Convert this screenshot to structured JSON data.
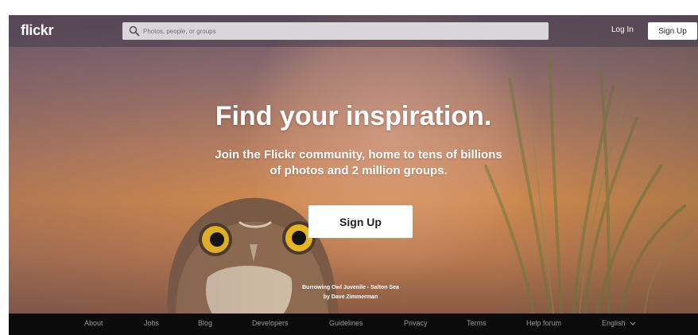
{
  "brand": {
    "logo_text": "flickr"
  },
  "search": {
    "placeholder": "Photos, people, or groups",
    "icon": "search-icon"
  },
  "nav": {
    "login_label": "Log In",
    "signup_label": "Sign Up"
  },
  "hero": {
    "headline": "Find your inspiration.",
    "subline_1": "Join the Flickr community, home to tens of billions",
    "subline_2": "of photos and 2 million groups.",
    "cta_label": "Sign Up",
    "photo_title": "Burrowing Owl Juvenile - Salton Sea",
    "photo_author": "by Dave Zimmerman"
  },
  "footer": {
    "links": [
      "About",
      "Jobs",
      "Blog",
      "Developers",
      "Guidelines",
      "Privacy",
      "Terms",
      "Help forum"
    ],
    "language": "English",
    "language_icon": "chevron-down-icon"
  },
  "colors": {
    "topbar": "#46404b",
    "footer": "#0b0b0b",
    "cta_bg": "#ffffff",
    "search_bg": "#d9d6da"
  }
}
